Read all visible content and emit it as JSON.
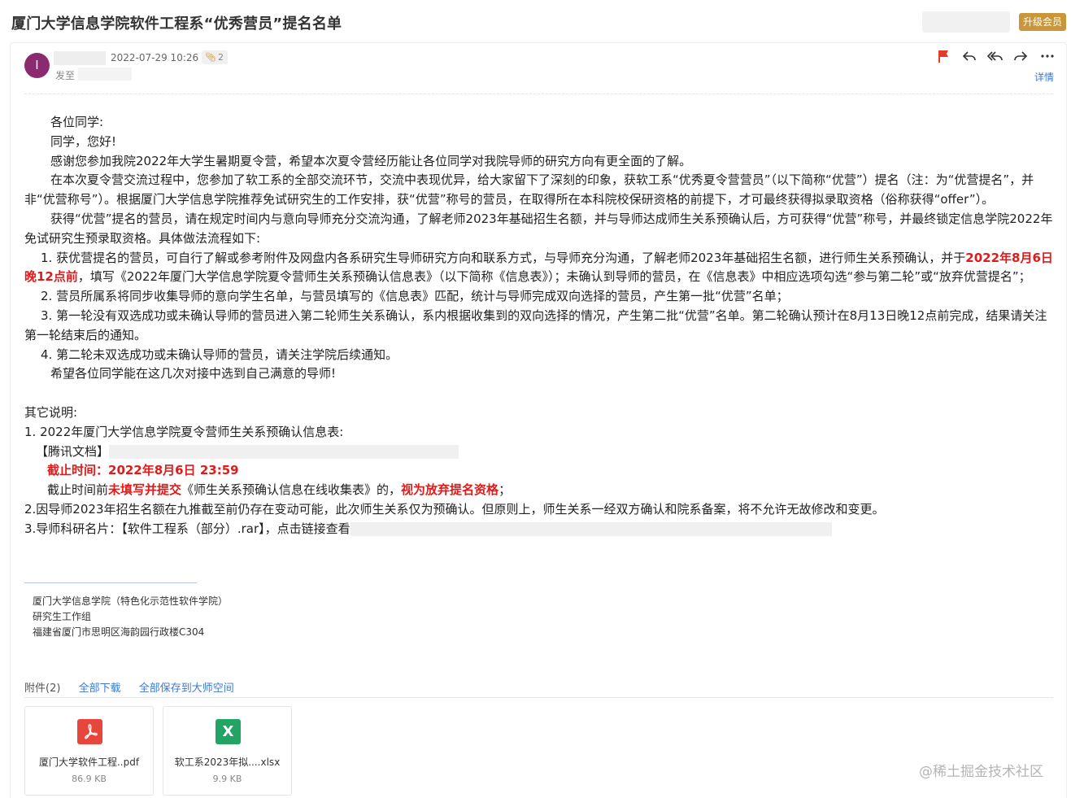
{
  "header": {
    "subject": "厦门大学信息学院软件工程系“优秀营员”提名名单",
    "upgrade_label": "升级会员"
  },
  "sender": {
    "avatar_letter": "I",
    "datetime": "2022-07-29 10:26",
    "attachment_count": "2",
    "sent_to_label": "发至"
  },
  "actions": {
    "detail_label": "详情",
    "flag_icon": "flag-icon",
    "reply_icon": "reply-icon",
    "reply_all_icon": "reply-all-icon",
    "forward_icon": "forward-icon",
    "more_icon": "more-icon"
  },
  "body": {
    "greeting": "各位同学:",
    "hello": "同学，您好!",
    "p1": "感谢您参加我院2022年大学生暑期夏令营，希望本次夏令营经历能让各位同学对我院导师的研究方向有更全面的了解。",
    "p2": "在本次夏令营交流过程中，您参加了软工系的全部交流环节，交流中表现优异，给大家留下了深刻的印象，获软工系“优秀夏令营营员”（以下简称“优营”）提名（注：为“优营提名”，并非“优营称号”）。根据厦门大学信息学院推荐免试研究生的工作安排，获“优营”称号的营员，在取得所在本科院校保研资格的前提下，才可最终获得拟录取资格（俗称获得“offer”）。",
    "p3": "获得“优营”提名的营员，请在规定时间内与意向导师充分交流沟通，了解老师2023年基础招生名额，并与导师达成师生关系预确认后，方可获得“优营”称号，并最终锁定信息学院2022年免试研究生预录取资格。具体做法流程如下:",
    "step1_a": "1. 获优营提名的营员，可自行了解或参考附件及网盘内各系研究生导师研究方向和联系方式，与导师充分沟通，了解老师2023年基础招生名额，进行师生关系预确认，并于",
    "step1_deadline": "2022年8月6日晚12点前",
    "step1_b": "，填写《2022年厦门大学信息学院夏令营师生关系预确认信息表》（以下简称《信息表》）；未确认到导师的营员，在《信息表》中相应选项勾选“参与第二轮”或“放弃优营提名”；",
    "step2": "2. 营员所属系将同步收集导师的意向学生名单，与营员填写的《信息表》匹配，统计与导师完成双向选择的营员，产生第一批“优营”名单；",
    "step3": "3. 第一轮没有双选成功或未确认导师的营员进入第二轮师生关系确认，系内根据收集到的双向选择的情况，产生第二批“优营”名单。第二轮确认预计在8月13日晚12点前完成，结果请关注第一轮结束后的通知。",
    "step4": "4. 第二轮未双选成功或未确认导师的营员，请关注学院后续通知。",
    "wish": "希望各位同学能在这几次对接中选到自己满意的导师!",
    "other_title": "其它说明:",
    "o1": "1. 2022年厦门大学信息学院夏令营师生关系预确认信息表:",
    "tencent_doc": "【腾讯文档】",
    "deadline": "截止时间：2022年8月6日 23:59",
    "note_a": "截止时间前",
    "note_b": "未填写并提交",
    "note_c": "《师生关系预确认信息在线收集表》的，",
    "note_d": "视为放弃提名资格",
    "note_e": "；",
    "o2": "2.因导师2023年招生名额在九推截至前仍存在变动可能，此次师生关系仅为预确认。但原则上，师生关系一经双方确认和院系备案，将不允许无故修改和变更。",
    "o3": "3.导师科研名片：【软件工程系（部分）.rar】，点击链接查看"
  },
  "signature": {
    "line1": "厦门大学信息学院（特色化示范性软件学院）",
    "line2": "研究生工作组",
    "line3": "福建省厦门市思明区海韵园行政楼C304"
  },
  "attachments": {
    "label": "附件(2)",
    "download_all": "全部下载",
    "save_all": "全部保存到大师空间",
    "files": [
      {
        "name": "厦门大学软件工程..pdf",
        "size": "86.9 KB",
        "icon": "pdf-icon",
        "glyph": "⅄"
      },
      {
        "name": "软工系2023年拟....xlsx",
        "size": "9.9 KB",
        "icon": "excel-icon",
        "glyph": "X"
      }
    ]
  },
  "watermark": "@稀土掘金技术社区"
}
